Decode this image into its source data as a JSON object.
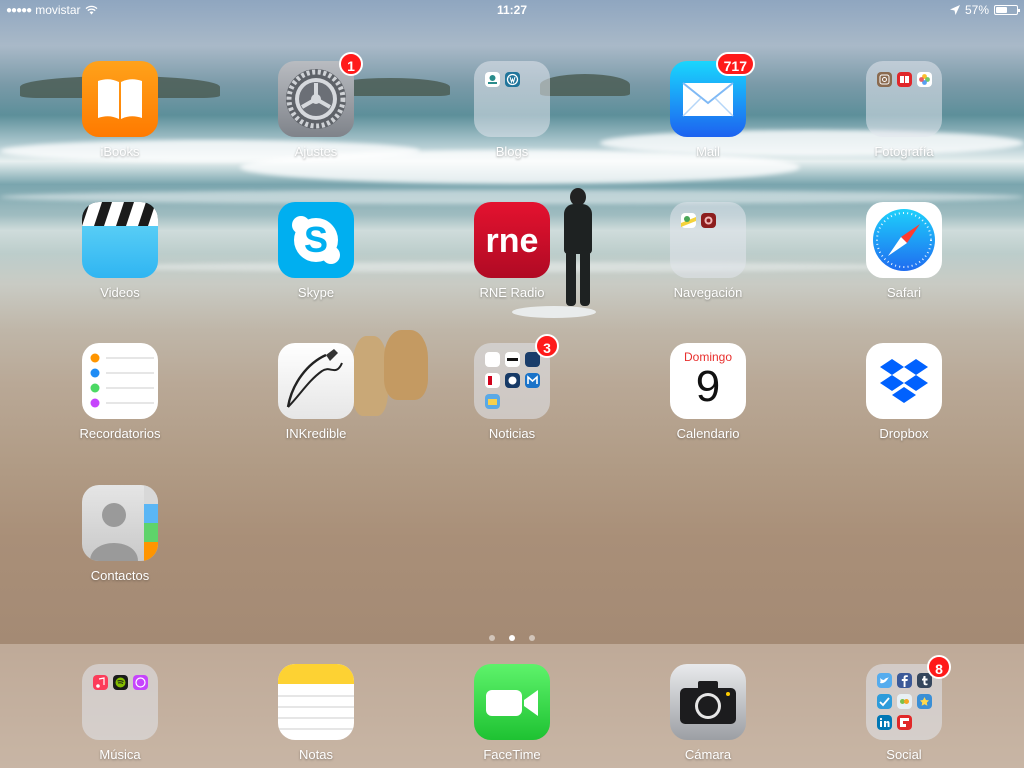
{
  "status_bar": {
    "carrier": "movistar",
    "time": "11:27",
    "battery": "57%",
    "battery_level": 0.57
  },
  "apps": {
    "ibooks": {
      "label": "iBooks"
    },
    "ajustes": {
      "label": "Ajustes",
      "badge": "1"
    },
    "blogs": {
      "label": "Blogs"
    },
    "mail": {
      "label": "Mail",
      "badge": "717"
    },
    "fotografia": {
      "label": "Fotografía"
    },
    "videos": {
      "label": "Videos"
    },
    "skype": {
      "label": "Skype"
    },
    "rne": {
      "label": "RNE Radio",
      "logo": "rne"
    },
    "navegacion": {
      "label": "Navegación"
    },
    "safari": {
      "label": "Safari"
    },
    "recordatorios": {
      "label": "Recordatorios"
    },
    "inkredible": {
      "label": "INKredible"
    },
    "noticias": {
      "label": "Noticias",
      "badge": "3"
    },
    "calendario": {
      "label": "Calendario",
      "weekday": "Domingo",
      "day": "9"
    },
    "dropbox": {
      "label": "Dropbox"
    },
    "contactos": {
      "label": "Contactos"
    }
  },
  "pager": {
    "pages": 3,
    "current": 2
  },
  "dock": {
    "musica": {
      "label": "Música"
    },
    "notas": {
      "label": "Notas"
    },
    "facetime": {
      "label": "FaceTime"
    },
    "camara": {
      "label": "Cámara"
    },
    "social": {
      "label": "Social",
      "badge": "8"
    }
  },
  "colors": {
    "badge": "#ff1a1a",
    "ibooks": "#ff8a00",
    "mail": "#1e8cf5",
    "skype": "#00aff0",
    "rne": "#d0102a",
    "facetime": "#35d44a",
    "dropbox": "#0061fe"
  }
}
